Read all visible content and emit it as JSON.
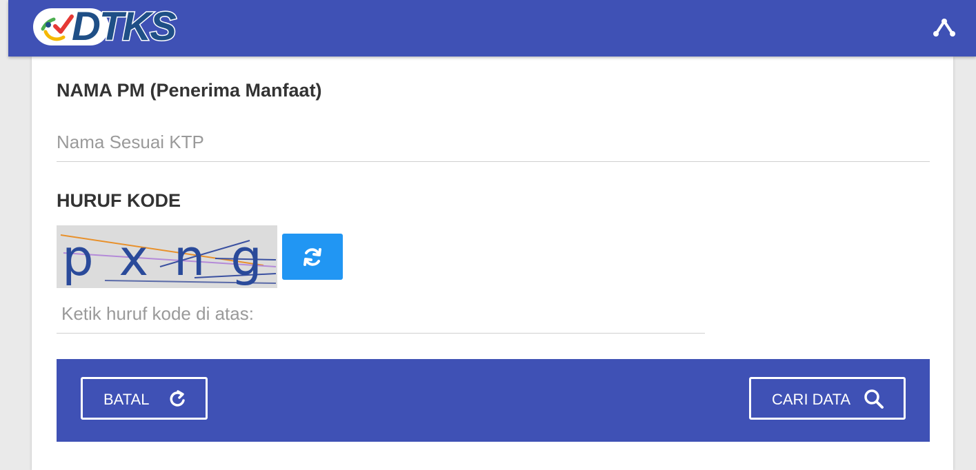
{
  "header": {
    "logo_text": "DTKS",
    "menu_icon": "chevron-up-icon"
  },
  "form": {
    "name_label": "NAMA PM (Penerima Manfaat)",
    "name_placeholder": "Nama Sesuai KTP",
    "code_label": "HURUF KODE",
    "captcha_text": "pxng",
    "refresh_icon": "refresh-icon",
    "code_placeholder": "Ketik huruf kode di atas:"
  },
  "actions": {
    "cancel_label": "BATAL",
    "cancel_icon": "reset-icon",
    "search_label": "CARI DATA",
    "search_icon": "search-icon"
  },
  "colors": {
    "primary": "#3f51b5",
    "accent": "#2196f3",
    "logo_blue": "#1f4f86"
  }
}
